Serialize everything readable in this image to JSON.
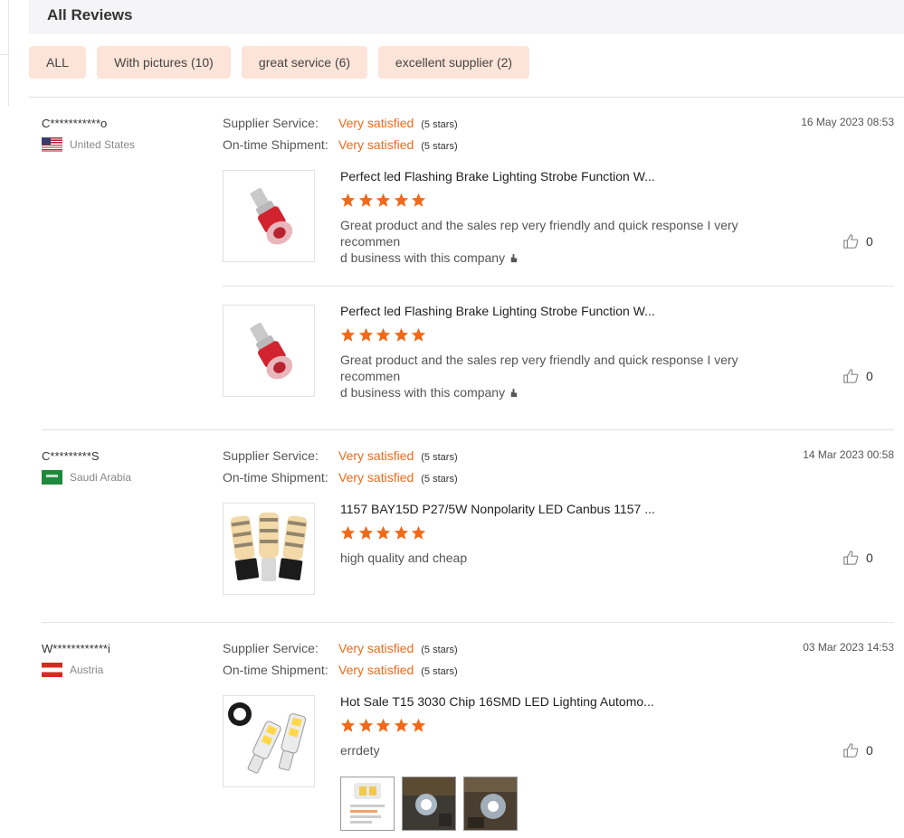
{
  "header": {
    "title": "All Reviews"
  },
  "filters": [
    {
      "label": "ALL"
    },
    {
      "label": "With pictures (10)"
    },
    {
      "label": "great service (6)"
    },
    {
      "label": "excellent supplier (2)"
    }
  ],
  "icons": {
    "star": "star-icon",
    "like": "thumbs-up-icon",
    "hand": "pointing-hand-icon"
  },
  "colors": {
    "accent": "#f06a1a",
    "chip_bg": "#fde4d8",
    "star": "#f06a1a"
  },
  "rating_labels": {
    "supplier": "Supplier Service:",
    "shipment": "On-time Shipment:"
  },
  "reviews": [
    {
      "user": "C***********o",
      "country": "United States",
      "date": "16 May 2023 08:53",
      "supplier_rating": "Very satisfied",
      "supplier_stars": "(5 stars)",
      "shipment_rating": "Very satisfied",
      "shipment_stars": "(5 stars)",
      "items": [
        {
          "title": "Perfect led Flashing Brake Lighting Strobe Function W...",
          "rating": 5,
          "text_line1": "Great product and the sales rep very friendly and quick response I very recommen",
          "text_line2": "d business with this company",
          "likes": "0"
        },
        {
          "title": "Perfect led Flashing Brake Lighting Strobe Function W...",
          "rating": 5,
          "text_line1": "Great product and the sales rep very friendly and quick response I very recommen",
          "text_line2": "d business with this company",
          "likes": "0"
        }
      ]
    },
    {
      "user": "C*********S",
      "country": "Saudi Arabia",
      "date": "14 Mar 2023 00:58",
      "supplier_rating": "Very satisfied",
      "supplier_stars": "(5 stars)",
      "shipment_rating": "Very satisfied",
      "shipment_stars": "(5 stars)",
      "items": [
        {
          "title": "1157 BAY15D P27/5W Nonpolarity LED Canbus 1157 ...",
          "rating": 5,
          "text_line1": "high quality and cheap",
          "likes": "0"
        }
      ]
    },
    {
      "user": "W************i",
      "country": "Austria",
      "date": "03 Mar 2023 14:53",
      "supplier_rating": "Very satisfied",
      "supplier_stars": "(5 stars)",
      "shipment_rating": "Very satisfied",
      "shipment_stars": "(5 stars)",
      "items": [
        {
          "title": "Hot Sale T15 3030 Chip 16SMD LED Lighting Automo...",
          "rating": 5,
          "text_line1": "errdety",
          "likes": "0",
          "photos": 3
        }
      ]
    }
  ]
}
